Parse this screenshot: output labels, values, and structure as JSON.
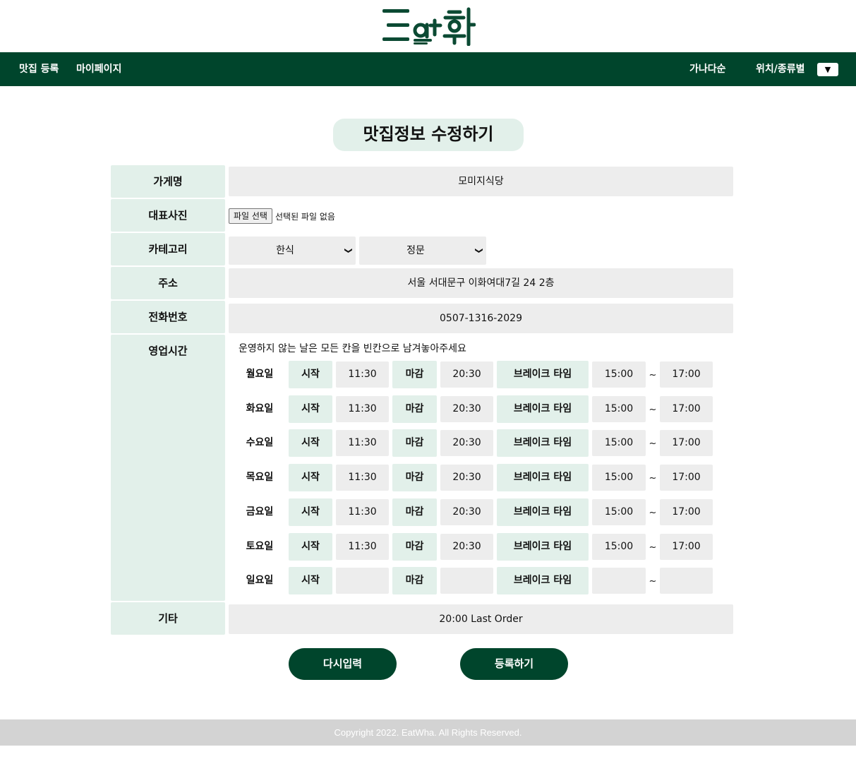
{
  "colors": {
    "primary": "#00452c",
    "label_bg": "#e2f0ea",
    "input_bg": "#ededed",
    "footer_bg": "#d3d3d3"
  },
  "brand": {
    "logo_text": "Eat화"
  },
  "nav": {
    "register": "맛집 등록",
    "mypage": "마이페이지",
    "sort_alpha": "가나다순",
    "filter": "위치/종류별",
    "dropdown_icon": "▼"
  },
  "page": {
    "title": "맛집정보 수정하기"
  },
  "form": {
    "name": {
      "label": "가게명",
      "value": "모미지식당"
    },
    "photo": {
      "label": "대표사진",
      "button": "파일 선택",
      "status": "선택된 파일 없음"
    },
    "category": {
      "label": "카테고리",
      "main": "한식",
      "sub": "정문"
    },
    "address": {
      "label": "주소",
      "value": "서울 서대문구 이화여대7길 24 2층"
    },
    "phone": {
      "label": "전화번호",
      "value": "0507-1316-2029"
    },
    "hours": {
      "label": "영업시간",
      "note": "운영하지 않는 날은 모든 칸을 빈칸으로 남겨놓아주세요",
      "start_label": "시작",
      "end_label": "마감",
      "break_label": "브레이크 타임",
      "tilde": "~",
      "days": [
        {
          "day": "월요일",
          "start": "11:30",
          "end": "20:30",
          "break_start": "15:00",
          "break_end": "17:00"
        },
        {
          "day": "화요일",
          "start": "11:30",
          "end": "20:30",
          "break_start": "15:00",
          "break_end": "17:00"
        },
        {
          "day": "수요일",
          "start": "11:30",
          "end": "20:30",
          "break_start": "15:00",
          "break_end": "17:00"
        },
        {
          "day": "목요일",
          "start": "11:30",
          "end": "20:30",
          "break_start": "15:00",
          "break_end": "17:00"
        },
        {
          "day": "금요일",
          "start": "11:30",
          "end": "20:30",
          "break_start": "15:00",
          "break_end": "17:00"
        },
        {
          "day": "토요일",
          "start": "11:30",
          "end": "20:30",
          "break_start": "15:00",
          "break_end": "17:00"
        },
        {
          "day": "일요일",
          "start": "",
          "end": "",
          "break_start": "",
          "break_end": ""
        }
      ]
    },
    "etc": {
      "label": "기타",
      "value": "20:00 Last Order"
    }
  },
  "actions": {
    "reset": "다시입력",
    "submit": "등록하기"
  },
  "footer": {
    "copyright": "Copyright 2022. EatWha. All Rights Reserved."
  }
}
